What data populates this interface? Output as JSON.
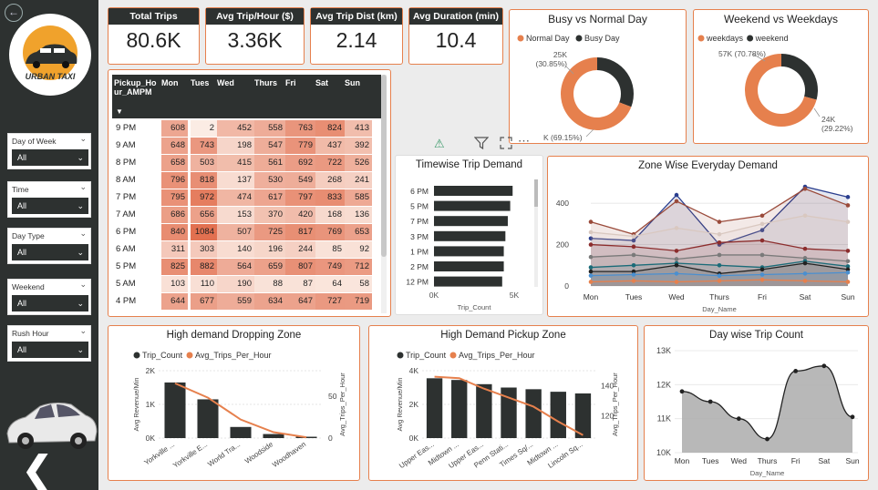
{
  "sidebar": {
    "logo_text": "URBAN TAXI",
    "filters": [
      {
        "label": "Day of Week",
        "value": "All"
      },
      {
        "label": "Time",
        "value": "All"
      },
      {
        "label": "Day Type",
        "value": "All"
      },
      {
        "label": "Weekend",
        "value": "All"
      },
      {
        "label": "Rush Hour",
        "value": "All"
      }
    ]
  },
  "kpis": [
    {
      "label": "Total Trips",
      "value": "80.6K"
    },
    {
      "label": "Avg Trip/Hour ($)",
      "value": "3.36K"
    },
    {
      "label": "Avg Trip Dist (km)",
      "value": "2.14"
    },
    {
      "label": "Avg Duration (min)",
      "value": "10.4"
    }
  ],
  "matrix": {
    "row_header": "Pickup_Hour_AMPM",
    "columns": [
      "Mon",
      "Tues",
      "Wed",
      "Thurs",
      "Fri",
      "Sat",
      "Sun"
    ],
    "rows": [
      {
        "label": "9 PM",
        "values": [
          608,
          2,
          452,
          558,
          763,
          824,
          413
        ]
      },
      {
        "label": "9 AM",
        "values": [
          648,
          743,
          198,
          547,
          779,
          437,
          392
        ]
      },
      {
        "label": "8 PM",
        "values": [
          658,
          503,
          415,
          561,
          692,
          722,
          526
        ]
      },
      {
        "label": "8 AM",
        "values": [
          796,
          818,
          137,
          530,
          549,
          268,
          241
        ]
      },
      {
        "label": "7 PM",
        "values": [
          795,
          972,
          474,
          617,
          797,
          833,
          585
        ]
      },
      {
        "label": "7 AM",
        "values": [
          686,
          656,
          153,
          370,
          420,
          168,
          136
        ]
      },
      {
        "label": "6 PM",
        "values": [
          840,
          1084,
          507,
          725,
          817,
          769,
          653
        ]
      },
      {
        "label": "6 AM",
        "values": [
          311,
          303,
          140,
          196,
          244,
          85,
          92
        ]
      },
      {
        "label": "5 PM",
        "values": [
          825,
          882,
          564,
          659,
          807,
          749,
          712
        ]
      },
      {
        "label": "5 AM",
        "values": [
          103,
          110,
          190,
          88,
          87,
          64,
          58
        ]
      },
      {
        "label": "4 PM",
        "values": [
          644,
          677,
          559,
          634,
          647,
          727,
          719
        ]
      }
    ]
  },
  "colors": {
    "accent": "#e6804d",
    "dark": "#2d3130",
    "heat_high": "#e58060",
    "heat_low": "#fbe6dc"
  },
  "chart_data": [
    {
      "type": "pie",
      "title": "Busy vs Normal Day",
      "legend": [
        "Normal Day",
        "Busy Day"
      ],
      "slices": [
        {
          "name": "Normal Day",
          "value": 69.15,
          "label": "K (69.15%)",
          "color": "#e6804d"
        },
        {
          "name": "Busy Day",
          "value": 30.85,
          "label": "25K (30.85%)",
          "color": "#2d3130"
        }
      ]
    },
    {
      "type": "pie",
      "title": "Weekend vs Weekdays",
      "legend": [
        "weekdays",
        "weekend"
      ],
      "slices": [
        {
          "name": "weekdays",
          "value": 70.78,
          "label": "57K (70.78%)",
          "color": "#e6804d"
        },
        {
          "name": "weekend",
          "value": 29.22,
          "label": "24K (29.22%)",
          "color": "#2d3130"
        }
      ]
    },
    {
      "type": "bar",
      "title": "Timewise Trip Demand",
      "categories": [
        "6 PM",
        "5 PM",
        "7 PM",
        "3 PM",
        "1 PM",
        "2 PM",
        "12 PM"
      ],
      "values": [
        4900,
        4750,
        4600,
        4450,
        4350,
        4350,
        4250
      ],
      "xlabel": "Trip_Count",
      "xticks": [
        "0K",
        "5K"
      ],
      "xlim": [
        0,
        5000
      ]
    },
    {
      "type": "area",
      "title": "Zone Wise Everyday Demand",
      "categories": [
        "Mon",
        "Tues",
        "Wed",
        "Thurs",
        "Fri",
        "Sat",
        "Sun"
      ],
      "xlabel": "Day_Name",
      "yticks": [
        "0",
        "200",
        "400"
      ],
      "ylim": [
        0,
        480
      ],
      "series": [
        {
          "color": "#2b3f8f",
          "values": [
            230,
            220,
            440,
            200,
            270,
            480,
            430
          ]
        },
        {
          "color": "#9a4a3a",
          "values": [
            310,
            250,
            410,
            310,
            340,
            470,
            390
          ]
        },
        {
          "color": "#d9c8c0",
          "values": [
            260,
            240,
            280,
            250,
            300,
            340,
            310
          ]
        },
        {
          "color": "#8c2d2d",
          "values": [
            200,
            190,
            170,
            210,
            220,
            180,
            170
          ]
        },
        {
          "color": "#7a7a7a",
          "values": [
            140,
            150,
            130,
            150,
            150,
            135,
            120
          ]
        },
        {
          "color": "#1a6b78",
          "values": [
            90,
            100,
            110,
            100,
            90,
            120,
            95
          ]
        },
        {
          "color": "#222222",
          "values": [
            70,
            70,
            100,
            60,
            80,
            110,
            80
          ]
        },
        {
          "color": "#4a8fd0",
          "values": [
            50,
            55,
            60,
            50,
            55,
            60,
            65
          ]
        },
        {
          "color": "#e6804d",
          "values": [
            20,
            25,
            20,
            25,
            30,
            25,
            20
          ]
        }
      ]
    },
    {
      "type": "bar",
      "title": "High demand Dropping Zone",
      "legend": [
        "Trip_Count",
        "Avg_Trips_Per_Hour"
      ],
      "categories": [
        "Yorkville ...",
        "Yorkville E...",
        "World Tra...",
        "Woodside",
        "Woodhaven"
      ],
      "values": [
        1650,
        1150,
        330,
        120,
        40
      ],
      "line_values": [
        65,
        48,
        22,
        7,
        1
      ],
      "ylabel": "Avg Revenue/Min",
      "y2label": "Avg_Trips_Per_Hour",
      "yticks": [
        "0K",
        "1K",
        "2K"
      ],
      "y2ticks": [
        "0",
        "50"
      ],
      "ylim": [
        0,
        2000
      ],
      "y2lim": [
        0,
        80
      ]
    },
    {
      "type": "bar",
      "title": "High Demand Pickup Zone",
      "legend": [
        "Trip_Count",
        "Avg_Trips_Per_Hour"
      ],
      "categories": [
        "Upper Eas...",
        "Midtown ...",
        "Upper Eas...",
        "Penn Stati...",
        "Times Sq/...",
        "Midtown ...",
        "Lincoln Sq..."
      ],
      "values": [
        3550,
        3450,
        3200,
        3000,
        2900,
        2750,
        2650
      ],
      "line_values": [
        146,
        145,
        138,
        132,
        126,
        116,
        107
      ],
      "ylabel": "Avg Revenue/Min",
      "y2label": "Avg_Trips_Per_Hour",
      "yticks": [
        "0K",
        "2K",
        "4K"
      ],
      "y2ticks": [
        "120",
        "140"
      ],
      "ylim": [
        0,
        4000
      ],
      "y2lim": [
        105,
        150
      ]
    },
    {
      "type": "area",
      "title": "Day wise Trip Count",
      "categories": [
        "Mon",
        "Tues",
        "Wed",
        "Thurs",
        "Fri",
        "Sat",
        "Sun"
      ],
      "values": [
        11800,
        11500,
        11000,
        10400,
        12400,
        12550,
        11050
      ],
      "xlabel": "Day_Name",
      "yticks": [
        "10K",
        "11K",
        "12K",
        "13K"
      ],
      "ylim": [
        10000,
        13000
      ]
    }
  ]
}
